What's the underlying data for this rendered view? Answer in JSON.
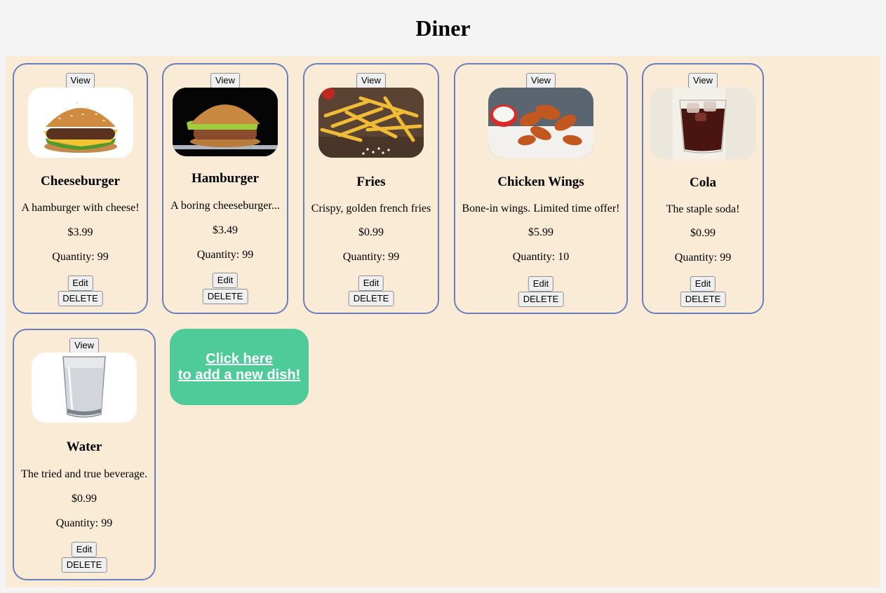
{
  "page": {
    "title": "Diner"
  },
  "dishes": [
    {
      "view_label": "View",
      "photo": "cheeseburger-photo",
      "name": "Cheeseburger",
      "description": "A hamburger with cheese!",
      "price": "$3.99",
      "quantity": "Quantity: 99",
      "edit_label": "Edit",
      "delete_label": "DELETE"
    },
    {
      "view_label": "View",
      "photo": "hamburger-photo",
      "name": "Hamburger",
      "description": "A boring cheeseburger...",
      "price": "$3.49",
      "quantity": "Quantity: 99",
      "edit_label": "Edit",
      "delete_label": "DELETE"
    },
    {
      "view_label": "View",
      "photo": "fries-photo",
      "name": "Fries",
      "description": "Crispy, golden french fries",
      "price": "$0.99",
      "quantity": "Quantity: 99",
      "edit_label": "Edit",
      "delete_label": "DELETE"
    },
    {
      "view_label": "View",
      "photo": "chicken-wings-photo",
      "name": "Chicken Wings",
      "description": "Bone-in wings. Limited time offer!",
      "price": "$5.99",
      "quantity": "Quantity: 10",
      "edit_label": "Edit",
      "delete_label": "DELETE"
    },
    {
      "view_label": "View",
      "photo": "cola-photo",
      "name": "Cola",
      "description": "The staple soda!",
      "price": "$0.99",
      "quantity": "Quantity: 99",
      "edit_label": "Edit",
      "delete_label": "DELETE"
    },
    {
      "view_label": "View",
      "photo": "water-photo",
      "name": "Water",
      "description": "The tried and true beverage.",
      "price": "$0.99",
      "quantity": "Quantity: 99",
      "edit_label": "Edit",
      "delete_label": "DELETE"
    }
  ],
  "add_dish": {
    "line1": "Click here",
    "line2": "to add a new dish!"
  },
  "colors": {
    "page_background": "#f4f4f4",
    "menu_background": "#faebd7",
    "card_border": "#6a7fbe",
    "add_button": "#4ecb99"
  }
}
